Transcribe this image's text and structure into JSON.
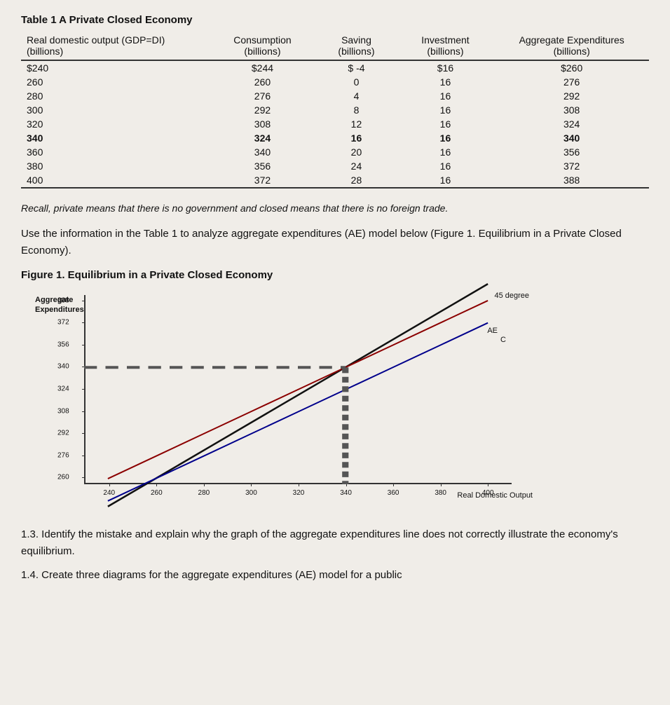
{
  "table": {
    "title": "Table 1  A Private Closed Economy",
    "headers": {
      "col1": "Real domestic output (GDP=DI) (billions)",
      "col2": "Consumption (billions)",
      "col3": "Saving (billions)",
      "col4": "Investment (billions)",
      "col5": "Aggregate Expenditures (billions)"
    },
    "rows": [
      {
        "gdp": "$240",
        "consumption": "$244",
        "saving": "$ -4",
        "investment": "$16",
        "aggregate": "$260",
        "bold": false
      },
      {
        "gdp": "260",
        "consumption": "260",
        "saving": "0",
        "investment": "16",
        "aggregate": "276",
        "bold": false
      },
      {
        "gdp": "280",
        "consumption": "276",
        "saving": "4",
        "investment": "16",
        "aggregate": "292",
        "bold": false
      },
      {
        "gdp": "300",
        "consumption": "292",
        "saving": "8",
        "investment": "16",
        "aggregate": "308",
        "bold": false
      },
      {
        "gdp": "320",
        "consumption": "308",
        "saving": "12",
        "investment": "16",
        "aggregate": "324",
        "bold": false
      },
      {
        "gdp": "340",
        "consumption": "324",
        "saving": "16",
        "investment": "16",
        "aggregate": "340",
        "bold": true
      },
      {
        "gdp": "360",
        "consumption": "340",
        "saving": "20",
        "investment": "16",
        "aggregate": "356",
        "bold": false
      },
      {
        "gdp": "380",
        "consumption": "356",
        "saving": "24",
        "investment": "16",
        "aggregate": "372",
        "bold": false
      },
      {
        "gdp": "400",
        "consumption": "372",
        "saving": "28",
        "investment": "16",
        "aggregate": "388",
        "bold": false
      }
    ]
  },
  "italic_note": "Recall, private means that there is no government and closed means that there is no foreign trade.",
  "use_text": "Use the information in the Table 1 to analyze aggregate expenditures (AE) model below (Figure 1. Equilibrium in a Private Closed Economy).",
  "figure_title": "Figure 1. Equilibrium in a Private Closed Economy",
  "chart": {
    "y_axis_label": "Aggregate\nExpenditures",
    "x_axis_label": "Real Domestic Output",
    "label_45": "45 degree",
    "label_ae": "AE",
    "label_c": "C",
    "y_ticks": [
      "388",
      "372",
      "356",
      "340",
      "324",
      "308",
      "292",
      "276",
      "260"
    ],
    "x_ticks": [
      "240",
      "260",
      "280",
      "300",
      "320",
      "340",
      "360",
      "380",
      "400"
    ]
  },
  "bottom_text": "1.3.  Identify the mistake and explain why the graph of the aggregate expenditures line does not correctly illustrate the economy's equilibrium.",
  "cut_text": "1.4.  Create three diagrams for the aggregate expenditures (AE) model for a public"
}
